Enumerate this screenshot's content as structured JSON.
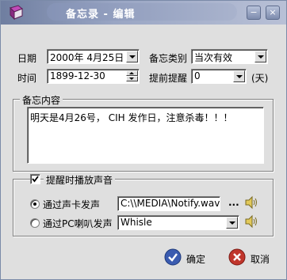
{
  "window": {
    "title": "备忘录 - 编辑",
    "app_icon": "book-icon",
    "minimize_label": "−",
    "close_label": "×"
  },
  "form": {
    "date_label": "日期",
    "date_value": "2000年 4月25日",
    "category_label": "备忘类别",
    "category_value": "当次有效",
    "time_label": "时间",
    "time_value": "1899-12-30",
    "remind_label": "提前提醒",
    "remind_value": "0",
    "remind_unit": "(天)"
  },
  "content_group": {
    "title": "备忘内容",
    "text": "明天是4月26号， CIH 发作日，注意杀毒！！！"
  },
  "sound_group": {
    "checkbox_label": "提醒时播放声音",
    "checked": true,
    "option_soundcard_label": "通过声卡发声",
    "soundcard_file": "C:\\\\MEDIA\\Notify.wav",
    "browse_label": "...",
    "option_pc_label": "通过PC喇叭发声",
    "pc_sound_value": "Whisle",
    "selected_option": "soundcard"
  },
  "buttons": {
    "ok_label": "确定",
    "cancel_label": "取消"
  },
  "colors": {
    "titlebar": "#8593b6",
    "ok_icon": "#3a5bb0",
    "cancel_icon": "#c0352b"
  }
}
